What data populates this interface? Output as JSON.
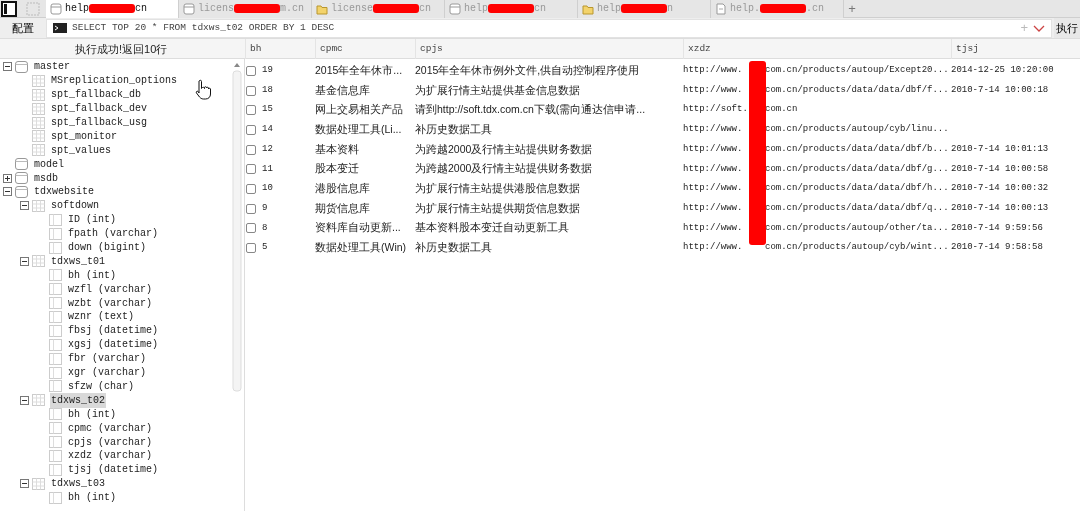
{
  "tabs": [
    {
      "prefix": "help",
      "suffix": "cn",
      "kind": "page",
      "selected": true
    },
    {
      "prefix": "licens",
      "suffix": "m.cn",
      "kind": "page",
      "selected": false
    },
    {
      "prefix": "license",
      "suffix": "cn",
      "kind": "folder",
      "selected": false
    },
    {
      "prefix": "help",
      "suffix": "cn",
      "kind": "page",
      "selected": false
    },
    {
      "prefix": "help",
      "suffix": "n",
      "kind": "folder",
      "selected": false
    },
    {
      "prefix": "help.",
      "suffix": ".cn",
      "kind": "doc",
      "selected": false
    }
  ],
  "new_tab": "+",
  "toolbar": {
    "config_button": "配置",
    "query": "SELECT TOP 20 * FROM tdxws_t02 ORDER BY 1 DESC",
    "add": "+",
    "run_button": "执行"
  },
  "status": "执行成功!返回10行",
  "tree": [
    {
      "label": "master",
      "kind": "database",
      "expanded": true,
      "children": [
        {
          "label": "MSreplication_options",
          "kind": "table"
        },
        {
          "label": "spt_fallback_db",
          "kind": "table"
        },
        {
          "label": "spt_fallback_dev",
          "kind": "table"
        },
        {
          "label": "spt_fallback_usg",
          "kind": "table"
        },
        {
          "label": "spt_monitor",
          "kind": "table"
        },
        {
          "label": "spt_values",
          "kind": "table"
        }
      ]
    },
    {
      "label": "model",
      "kind": "database"
    },
    {
      "label": "msdb",
      "kind": "database",
      "expanded": false
    },
    {
      "label": "tdxwebsite",
      "kind": "database",
      "expanded": true,
      "children": [
        {
          "label": "softdown",
          "kind": "table",
          "expanded": true,
          "selected": false,
          "children": [
            {
              "label": "ID (int)",
              "kind": "column"
            },
            {
              "label": "fpath (varchar)",
              "kind": "column"
            },
            {
              "label": "down (bigint)",
              "kind": "column"
            }
          ]
        },
        {
          "label": "tdxws_t01",
          "kind": "table",
          "expanded": true,
          "selected": false,
          "children": [
            {
              "label": "bh (int)",
              "kind": "column"
            },
            {
              "label": "wzfl (varchar)",
              "kind": "column"
            },
            {
              "label": "wzbt (varchar)",
              "kind": "column"
            },
            {
              "label": "wznr (text)",
              "kind": "column"
            },
            {
              "label": "fbsj (datetime)",
              "kind": "column"
            },
            {
              "label": "xgsj (datetime)",
              "kind": "column"
            },
            {
              "label": "fbr (varchar)",
              "kind": "column"
            },
            {
              "label": "xgr (varchar)",
              "kind": "column"
            },
            {
              "label": "sfzw (char)",
              "kind": "column"
            }
          ]
        },
        {
          "label": "tdxws_t02",
          "kind": "table",
          "expanded": true,
          "selected": true,
          "children": [
            {
              "label": "bh (int)",
              "kind": "column"
            },
            {
              "label": "cpmc (varchar)",
              "kind": "column"
            },
            {
              "label": "cpjs (varchar)",
              "kind": "column"
            },
            {
              "label": "xzdz (varchar)",
              "kind": "column"
            },
            {
              "label": "tjsj (datetime)",
              "kind": "column"
            }
          ]
        },
        {
          "label": "tdxws_t03",
          "kind": "table",
          "expanded": true,
          "selected": false,
          "children": [
            {
              "label": "bh (int)",
              "kind": "column"
            }
          ]
        }
      ]
    }
  ],
  "table": {
    "columns": [
      "bh",
      "cpmc",
      "cpjs",
      "xzdz",
      "tjsj"
    ],
    "rows": [
      {
        "checked": false,
        "bh": "19",
        "cpmc": "2015年全年休市...",
        "cpjs": "2015年全年休市例外文件,供自动控制程序使用",
        "xzdz_start": "http://www.",
        "xzdz_end": "com.cn/products/autoup/Except20...",
        "tjsj": "2014-12-25 10:20:00"
      },
      {
        "checked": false,
        "bh": "18",
        "cpmc": "基金信息库",
        "cpjs": "为扩展行情主站提供基金信息数据",
        "xzdz_start": "http://www.",
        "xzdz_end": "com.cn/products/data/data/dbf/f...",
        "tjsj": "2010-7-14 10:00:18"
      },
      {
        "checked": false,
        "bh": "15",
        "cpmc": "网上交易相关产品",
        "cpjs": "请到http://soft.tdx.com.cn下载(需向通达信申请...",
        "xzdz_start": "http://soft.",
        "xzdz_end": "com.cn"
      },
      {
        "checked": false,
        "bh": "14",
        "cpmc": "数据处理工具(Li...",
        "cpjs": "补历史数据工具",
        "xzdz_start": "http://www.",
        "xzdz_end": "com.cn/products/autoup/cyb/linu..."
      },
      {
        "checked": false,
        "bh": "12",
        "cpmc": "基本资料",
        "cpjs": "为跨越2000及行情主站提供财务数据",
        "xzdz_start": "http://www.",
        "xzdz_end": "com.cn/products/data/data/dbf/b...",
        "tjsj": "2010-7-14 10:01:13"
      },
      {
        "checked": false,
        "bh": "11",
        "cpmc": "股本变迁",
        "cpjs": "为跨越2000及行情主站提供财务数据",
        "xzdz_start": "http://www.",
        "xzdz_end": "com.cn/products/data/data/dbf/g...",
        "tjsj": "2010-7-14 10:00:58"
      },
      {
        "checked": false,
        "bh": "10",
        "cpmc": "港股信息库",
        "cpjs": "为扩展行情主站提供港股信息数据",
        "xzdz_start": "http://www.",
        "xzdz_end": "com.cn/products/data/data/dbf/h...",
        "tjsj": "2010-7-14 10:00:32"
      },
      {
        "checked": false,
        "bh": "9",
        "cpmc": "期货信息库",
        "cpjs": "为扩展行情主站提供期货信息数据",
        "xzdz_start": "http://www.",
        "xzdz_end": "com.cn/products/data/data/dbf/q...",
        "tjsj": "2010-7-14 10:00:13"
      },
      {
        "checked": false,
        "bh": "8",
        "cpmc": "资料库自动更新...",
        "cpjs": "基本资料股本变迁自动更新工具",
        "xzdz_start": "http://www.",
        "xzdz_end": "com.cn/products/autoup/other/ta...",
        "tjsj": "2010-7-14 9:59:56"
      },
      {
        "checked": false,
        "bh": "5",
        "cpmc": "数据处理工具(Win)",
        "cpjs": "补历史数据工具",
        "xzdz_start": "http://www.",
        "xzdz_end": "com.cn/products/autoup/cyb/wint...",
        "tjsj": "2010-7-14 9:58:58"
      }
    ]
  }
}
